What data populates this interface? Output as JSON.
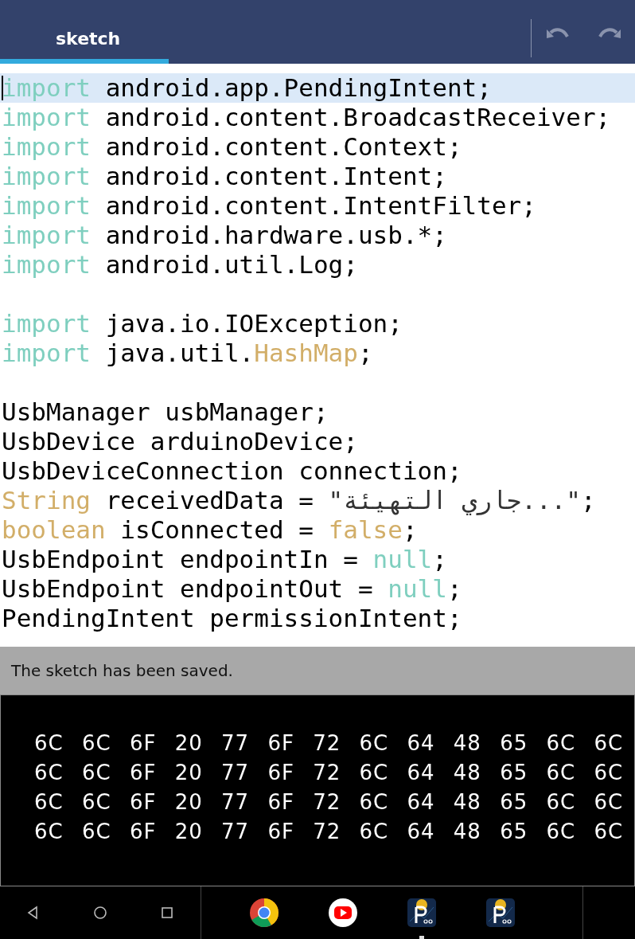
{
  "tabs": [
    {
      "label": "sketch",
      "selected": true
    }
  ],
  "editor": {
    "lines": [
      {
        "kind": "code",
        "highlighted": true,
        "tokens": [
          {
            "text": "import",
            "kind": "keyword"
          },
          {
            "text": " android.app.PendingIntent;",
            "kind": "plain"
          }
        ]
      },
      {
        "kind": "code",
        "highlighted": false,
        "tokens": [
          {
            "text": "import",
            "kind": "keyword"
          },
          {
            "text": " android.content.BroadcastReceiver;",
            "kind": "plain"
          }
        ]
      },
      {
        "kind": "code",
        "highlighted": false,
        "tokens": [
          {
            "text": "import",
            "kind": "keyword"
          },
          {
            "text": " android.content.Context;",
            "kind": "plain"
          }
        ]
      },
      {
        "kind": "code",
        "highlighted": false,
        "tokens": [
          {
            "text": "import",
            "kind": "keyword"
          },
          {
            "text": " android.content.Intent;",
            "kind": "plain"
          }
        ]
      },
      {
        "kind": "code",
        "highlighted": false,
        "tokens": [
          {
            "text": "import",
            "kind": "keyword"
          },
          {
            "text": " android.content.IntentFilter;",
            "kind": "plain"
          }
        ]
      },
      {
        "kind": "code",
        "highlighted": false,
        "tokens": [
          {
            "text": "import",
            "kind": "keyword"
          },
          {
            "text": " android.hardware.usb.*;",
            "kind": "plain"
          }
        ]
      },
      {
        "kind": "code",
        "highlighted": false,
        "tokens": [
          {
            "text": "import",
            "kind": "keyword"
          },
          {
            "text": " android.util.Log;",
            "kind": "plain"
          }
        ]
      },
      {
        "kind": "blank",
        "highlighted": false
      },
      {
        "kind": "code",
        "highlighted": false,
        "tokens": [
          {
            "text": "import",
            "kind": "keyword"
          },
          {
            "text": " java.io.IOException;",
            "kind": "plain"
          }
        ]
      },
      {
        "kind": "code",
        "highlighted": false,
        "tokens": [
          {
            "text": "import",
            "kind": "keyword"
          },
          {
            "text": " java.util.",
            "kind": "plain"
          },
          {
            "text": "HashMap",
            "kind": "type"
          },
          {
            "text": ";",
            "kind": "plain"
          }
        ]
      },
      {
        "kind": "blank",
        "highlighted": false
      },
      {
        "kind": "code",
        "highlighted": false,
        "tokens": [
          {
            "text": "UsbManager usbManager;",
            "kind": "plain"
          }
        ]
      },
      {
        "kind": "code",
        "highlighted": false,
        "tokens": [
          {
            "text": "UsbDevice arduinoDevice;",
            "kind": "plain"
          }
        ]
      },
      {
        "kind": "code",
        "highlighted": false,
        "tokens": [
          {
            "text": "UsbDeviceConnection connection;",
            "kind": "plain"
          }
        ]
      },
      {
        "kind": "code",
        "highlighted": false,
        "tokens": [
          {
            "text": "String",
            "kind": "type"
          },
          {
            "text": " receivedData = ",
            "kind": "plain"
          },
          {
            "text": "\"جاري التهيئة...\"",
            "kind": "string"
          },
          {
            "text": ";",
            "kind": "plain"
          }
        ]
      },
      {
        "kind": "code",
        "highlighted": false,
        "tokens": [
          {
            "text": "boolean",
            "kind": "type"
          },
          {
            "text": " isConnected = ",
            "kind": "plain"
          },
          {
            "text": "false",
            "kind": "type"
          },
          {
            "text": ";",
            "kind": "plain"
          }
        ]
      },
      {
        "kind": "code",
        "highlighted": false,
        "tokens": [
          {
            "text": "UsbEndpoint endpointIn = ",
            "kind": "plain"
          },
          {
            "text": "null",
            "kind": "keyword"
          },
          {
            "text": ";",
            "kind": "plain"
          }
        ]
      },
      {
        "kind": "code",
        "highlighted": false,
        "tokens": [
          {
            "text": "UsbEndpoint endpointOut = ",
            "kind": "plain"
          },
          {
            "text": "null",
            "kind": "keyword"
          },
          {
            "text": ";",
            "kind": "plain"
          }
        ]
      },
      {
        "kind": "code",
        "highlighted": false,
        "tokens": [
          {
            "text": "PendingIntent permissionIntent;",
            "kind": "plain"
          }
        ]
      }
    ]
  },
  "status_message": "The sketch has been saved.",
  "console": {
    "lines": [
      "6C 6C 6F 20 77 6F 72 6C 64 48 65 6C 6C",
      "6C 6C 6F 20 77 6F 72 6C 64 48 65 6C 6C",
      "6C 6C 6F 20 77 6F 72 6C 64 48 65 6C 6C",
      "6C 6C 6F 20 77 6F 72 6C 64 48 65 6C 6C"
    ]
  },
  "taskbar": {
    "apps": [
      {
        "kind": "chrome",
        "running": false
      },
      {
        "kind": "youtube",
        "running": false
      },
      {
        "kind": "processing",
        "running": true
      },
      {
        "kind": "processing",
        "running": false
      }
    ]
  }
}
